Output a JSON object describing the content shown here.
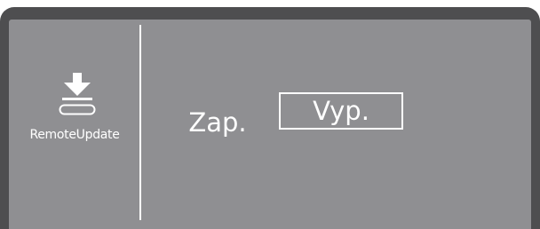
{
  "colors": {
    "bezel": "#4e4e50",
    "screen": "#8f8f92",
    "foreground": "#ffffff"
  },
  "menu": {
    "icon": "download-to-tray-icon",
    "label": "RemoteUpdate"
  },
  "options": {
    "on_label": "Zap.",
    "off_label": "Vyp.",
    "selected": "Vyp."
  }
}
